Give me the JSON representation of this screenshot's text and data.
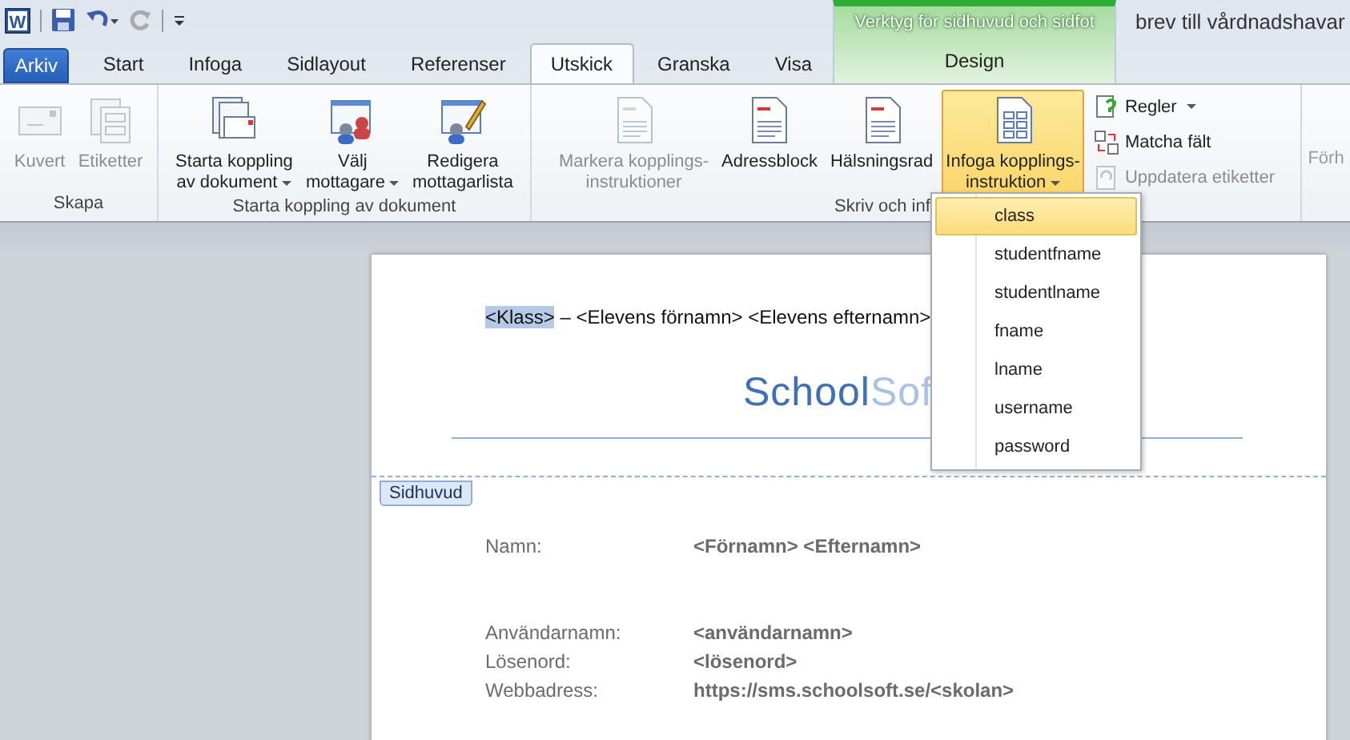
{
  "window": {
    "title": "brev till vårdnadshavar",
    "app_icon_letter": "W"
  },
  "contextual_group": {
    "title": "Verktyg för sidhuvud och sidfot",
    "tab": {
      "label": "Design",
      "selected": false
    }
  },
  "tabs": [
    {
      "label": "Arkiv",
      "kind": "file",
      "selected": false
    },
    {
      "label": "Start",
      "kind": "tab",
      "selected": false
    },
    {
      "label": "Infoga",
      "kind": "tab",
      "selected": false
    },
    {
      "label": "Sidlayout",
      "kind": "tab",
      "selected": false
    },
    {
      "label": "Referenser",
      "kind": "tab",
      "selected": false
    },
    {
      "label": "Utskick",
      "kind": "tab",
      "selected": true
    },
    {
      "label": "Granska",
      "kind": "tab",
      "selected": false
    },
    {
      "label": "Visa",
      "kind": "tab",
      "selected": false
    }
  ],
  "ribbon_groups": [
    {
      "label": "Skapa",
      "buttons": [
        {
          "lines": [
            "Kuvert"
          ],
          "disabled": true,
          "dropdown": false,
          "pressed": false
        },
        {
          "lines": [
            "Etiketter"
          ],
          "disabled": true,
          "dropdown": false,
          "pressed": false
        }
      ]
    },
    {
      "label": "Starta koppling av dokument",
      "buttons": [
        {
          "lines": [
            "Starta koppling",
            "av dokument"
          ],
          "disabled": false,
          "dropdown": true,
          "pressed": false
        },
        {
          "lines": [
            "Välj",
            "mottagare"
          ],
          "disabled": false,
          "dropdown": true,
          "pressed": false
        },
        {
          "lines": [
            "Redigera",
            "mottagarlista"
          ],
          "disabled": false,
          "dropdown": false,
          "pressed": false
        }
      ]
    },
    {
      "label": "Skriv och inf",
      "buttons": [
        {
          "lines": [
            "Markera kopplings-",
            "instruktioner"
          ],
          "disabled": true,
          "dropdown": false,
          "pressed": false
        },
        {
          "lines": [
            "Adressblock"
          ],
          "disabled": false,
          "dropdown": false,
          "pressed": false
        },
        {
          "lines": [
            "Hälsningsrad"
          ],
          "disabled": false,
          "dropdown": false,
          "pressed": false
        },
        {
          "lines": [
            "Infoga kopplings-",
            "instruktion"
          ],
          "disabled": false,
          "dropdown": true,
          "pressed": true
        }
      ],
      "small_buttons": [
        {
          "label": "Regler",
          "disabled": false,
          "dropdown": true
        },
        {
          "label": "Matcha fält",
          "disabled": false,
          "dropdown": false
        },
        {
          "label": "Uppdatera etiketter",
          "disabled": true,
          "dropdown": false
        }
      ]
    },
    {
      "cut_text": "Förh"
    }
  ],
  "merge_field_menu": [
    {
      "label": "class",
      "selected": true
    },
    {
      "label": "studentfname",
      "selected": false
    },
    {
      "label": "studentlname",
      "selected": false
    },
    {
      "label": "fname",
      "selected": false
    },
    {
      "label": "lname",
      "selected": false
    },
    {
      "label": "username",
      "selected": false
    },
    {
      "label": "password",
      "selected": false
    }
  ],
  "document": {
    "header_text": [
      {
        "text": "<Klass>",
        "selected": true
      },
      {
        "text": " – <Elevens förnamn> <Elevens efternamn>",
        "selected": false
      }
    ],
    "logo": {
      "primary": "School",
      "secondary": "Sof"
    },
    "header_tag": "Sidhuvud",
    "field_groups": [
      [
        {
          "label": "Namn:",
          "value": "<Förnamn> <Efternamn>"
        }
      ],
      [
        {
          "label": "Användarnamn:",
          "value": "<användarnamn>"
        },
        {
          "label": "Lösenord:",
          "value": "<lösenord>"
        },
        {
          "label": "Webbadress:",
          "value": "https://sms.schoolsoft.se/<skolan>"
        }
      ]
    ]
  }
}
